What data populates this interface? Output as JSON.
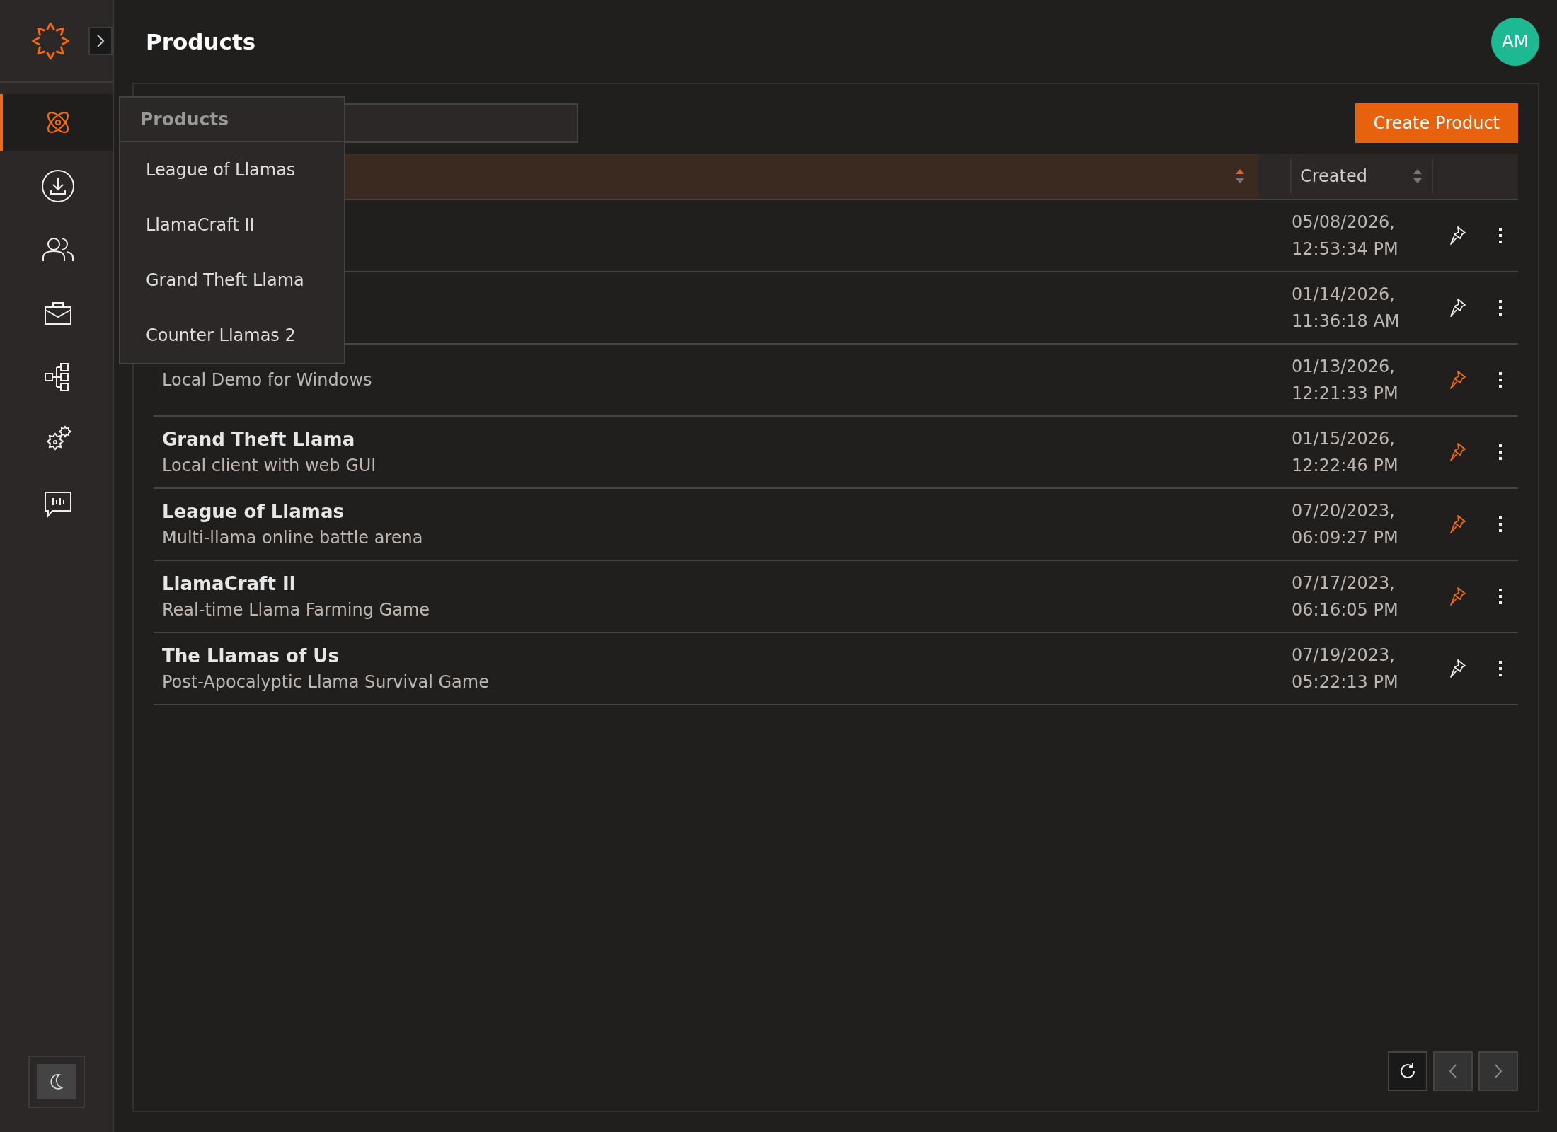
{
  "header": {
    "title": "Products",
    "avatar": "AM"
  },
  "sidebar": {
    "items": [
      {
        "selected": true
      },
      {
        "selected": false
      },
      {
        "selected": false
      },
      {
        "selected": false
      },
      {
        "selected": false
      },
      {
        "selected": false
      },
      {
        "selected": false
      }
    ]
  },
  "toolbar": {
    "create_button": "Create Product"
  },
  "table": {
    "columns": [
      {
        "sorted": true
      },
      {
        "label": "Created",
        "sorted": false
      }
    ],
    "rows": [
      {
        "created": "05/08/2026, 12:53:34 PM",
        "pinned": false
      },
      {
        "created": "01/14/2026, 11:36:18 AM",
        "pinned": false
      },
      {
        "subtitle": "Local Demo for Windows",
        "created": "01/13/2026, 12:21:33 PM",
        "pinned": true
      },
      {
        "title": "Grand Theft Llama",
        "subtitle": "Local client with web GUI",
        "created": "01/15/2026, 12:22:46 PM",
        "pinned": true
      },
      {
        "title": "League of Llamas",
        "subtitle": "Multi-llama online battle arena",
        "created": "07/20/2023, 06:09:27 PM",
        "pinned": true
      },
      {
        "title": "LlamaCraft II",
        "subtitle": "Real-time Llama Farming Game",
        "created": "07/17/2023, 06:16:05 PM",
        "pinned": true
      },
      {
        "title": "The Llamas of Us",
        "subtitle": "Post-Apocalyptic Llama Survival Game",
        "created": "07/19/2023, 05:22:13 PM",
        "pinned": false
      }
    ]
  },
  "dropdown": {
    "title": "Products",
    "items": [
      "League of Llamas",
      "LlamaCraft II",
      "Grand Theft Llama",
      "Counter Llamas 2"
    ]
  },
  "pagination": {
    "previous_disabled": true,
    "next_disabled": true
  }
}
